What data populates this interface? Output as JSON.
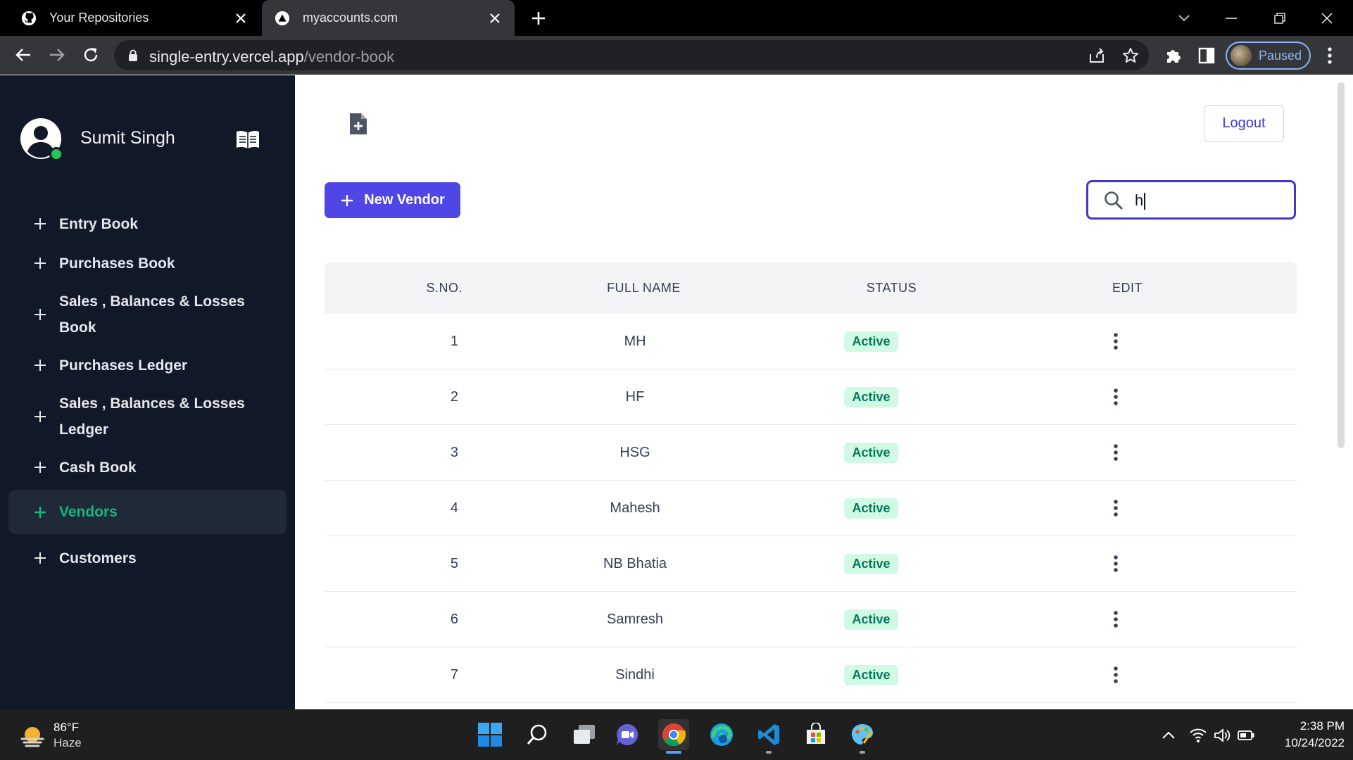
{
  "browser": {
    "tabs": [
      {
        "title": "Your Repositories",
        "icon": "github-icon",
        "active": false
      },
      {
        "title": "myaccounts.com",
        "icon": "vercel-icon",
        "active": true
      }
    ],
    "url_domain": "single-entry.vercel.app",
    "url_path": "/vendor-book",
    "profile_label": "Paused"
  },
  "sidebar": {
    "user_name": "Sumit Singh",
    "items": [
      {
        "label": "Entry Book",
        "active": false
      },
      {
        "label": "Purchases Book",
        "active": false
      },
      {
        "label": "Sales , Balances & Losses Book",
        "active": false
      },
      {
        "label": "Purchases Ledger",
        "active": false
      },
      {
        "label": "Sales , Balances & Losses Ledger",
        "active": false
      },
      {
        "label": "Cash Book",
        "active": false
      },
      {
        "label": "Vendors",
        "active": true
      },
      {
        "label": "Customers",
        "active": false
      }
    ],
    "active_color": "#10b981"
  },
  "header": {
    "logout_label": "Logout",
    "new_vendor_label": "New Vendor",
    "search_value": "h"
  },
  "table": {
    "columns": [
      "S.NO.",
      "FULL NAME",
      "STATUS",
      "EDIT"
    ],
    "rows": [
      {
        "sno": "1",
        "name": "MH",
        "status": "Active"
      },
      {
        "sno": "2",
        "name": "HF",
        "status": "Active"
      },
      {
        "sno": "3",
        "name": "HSG",
        "status": "Active"
      },
      {
        "sno": "4",
        "name": "Mahesh",
        "status": "Active"
      },
      {
        "sno": "5",
        "name": "NB Bhatia",
        "status": "Active"
      },
      {
        "sno": "6",
        "name": "Samresh",
        "status": "Active"
      },
      {
        "sno": "7",
        "name": "Sindhi",
        "status": "Active"
      }
    ]
  },
  "taskbar": {
    "temperature": "86°F",
    "condition": "Haze",
    "time": "2:38 PM",
    "date": "10/24/2022",
    "apps": [
      "windows-start-icon",
      "search-icon",
      "task-view-icon",
      "teams-chat-icon",
      "chrome-icon",
      "edge-icon",
      "vscode-icon",
      "ms-store-icon",
      "paint-icon"
    ]
  },
  "colors": {
    "primary": "#4f46e5",
    "sidebar_bg": "#111827",
    "badge_bg": "#d1fae5",
    "badge_text": "#047857"
  }
}
